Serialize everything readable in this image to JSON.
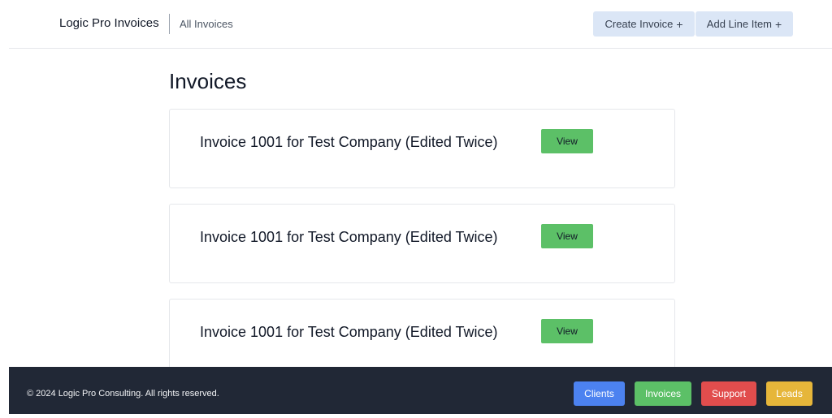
{
  "header": {
    "brand": "Logic Pro Invoices",
    "nav_link": "All Invoices",
    "create_invoice_label": "Create Invoice",
    "add_line_item_label": "Add Line Item",
    "plus_symbol": "+"
  },
  "main": {
    "title": "Invoices",
    "invoices": [
      {
        "title": "Invoice 1001 for Test Company (Edited Twice)",
        "view_label": "View"
      },
      {
        "title": "Invoice 1001 for Test Company (Edited Twice)",
        "view_label": "View"
      },
      {
        "title": "Invoice 1001 for Test Company (Edited Twice)",
        "view_label": "View"
      }
    ]
  },
  "footer": {
    "copyright": "© 2024 Logic Pro Consulting. All rights reserved.",
    "buttons": [
      {
        "label": "Clients",
        "color": "#4c82f0"
      },
      {
        "label": "Invoices",
        "color": "#5cc067"
      },
      {
        "label": "Support",
        "color": "#e14d4d"
      },
      {
        "label": "Leads",
        "color": "#e6b63a"
      }
    ]
  },
  "colors": {
    "header_button_bg": "#dbe6f6",
    "view_button_bg": "#5cc067",
    "footer_bg": "#212836"
  }
}
